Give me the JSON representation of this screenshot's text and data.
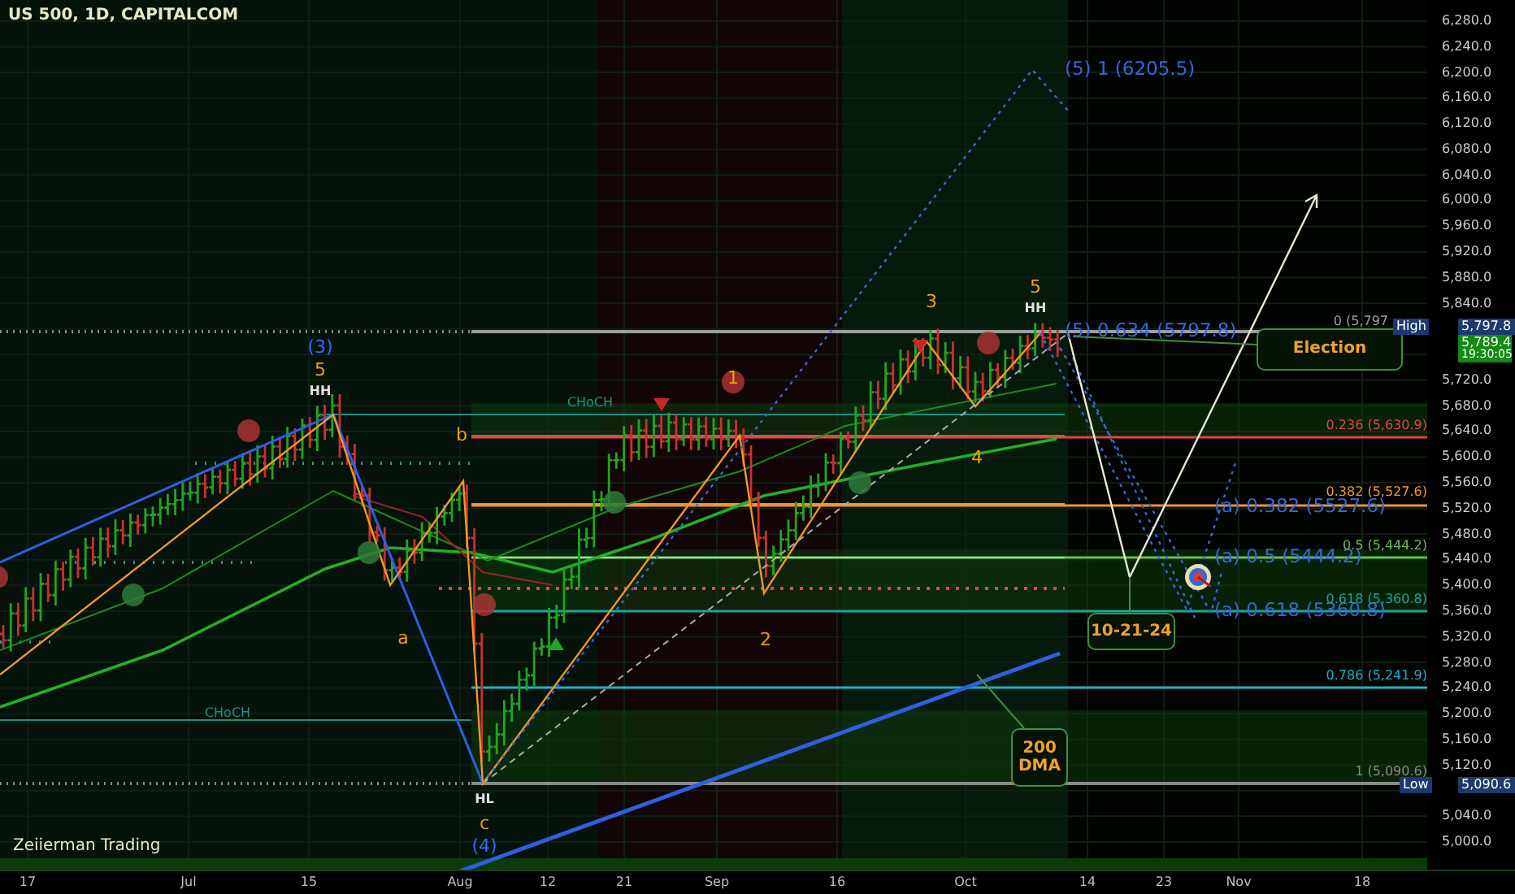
{
  "chart": {
    "title": "US 500, 1D, CAPITALCOM",
    "signature": "Zeiierman Trading",
    "wave_labels": [
      {
        "text": "(3)",
        "kind": "major"
      },
      {
        "text": "5",
        "kind": "minor"
      },
      {
        "text": "HH",
        "kind": "swing"
      },
      {
        "text": "1",
        "kind": "minor"
      },
      {
        "text": "3",
        "kind": "minor"
      },
      {
        "text": "5",
        "kind": "minor"
      },
      {
        "text": "HH",
        "kind": "swing"
      },
      {
        "text": "b",
        "kind": "minor"
      },
      {
        "text": "4",
        "kind": "minor"
      },
      {
        "text": "a",
        "kind": "minor"
      },
      {
        "text": "2",
        "kind": "minor"
      },
      {
        "text": "HL",
        "kind": "swing"
      },
      {
        "text": "c",
        "kind": "minor"
      },
      {
        "text": "(4)",
        "kind": "major"
      }
    ],
    "structure_labels": [
      "CHoCH",
      "CHoCH"
    ],
    "projection_labels": [
      "(5) 1 (6205.5)",
      "(5) 0.634 (5797.8)",
      "(a) 0.382 (5527.6)",
      "(a) 0.5 (5444.2)",
      "(a) 0.618 (5360.8)"
    ],
    "fib_levels": [
      {
        "label": "0 (5,797",
        "color": "#9e9e9e"
      },
      {
        "label": "0.236 (5,630.9)",
        "color": "#e04848"
      },
      {
        "label": "0.382 (5,527.6)",
        "color": "#f0962a"
      },
      {
        "label": "0.5 (5,444.2)",
        "color": "#6dbb5a"
      },
      {
        "label": "0.618 (5,360.8)",
        "color": "#1fa39a"
      },
      {
        "label": "0.786 (5,241.9)",
        "color": "#1fb0c0"
      },
      {
        "label": "1 (5,090.6)",
        "color": "#8a8a8a"
      }
    ],
    "callouts": [
      "Election",
      "10-21-24",
      "200 DMA"
    ],
    "price_axis": {
      "ticks": [
        "6,280.0",
        "6,240.0",
        "6,200.0",
        "6,160.0",
        "6,120.0",
        "6,080.0",
        "6,040.0",
        "6,000.0",
        "5,960.0",
        "5,920.0",
        "5,880.0",
        "5,840.0",
        "5,720.0",
        "5,680.0",
        "5,640.0",
        "5,600.0",
        "5,560.0",
        "5,520.0",
        "5,480.0",
        "5,440.0",
        "5,400.0",
        "5,360.0",
        "5,320.0",
        "5,280.0",
        "5,240.0",
        "5,200.0",
        "5,160.0",
        "5,120.0",
        "5,040.0",
        "5,000.0"
      ],
      "high": {
        "tag": "High",
        "price": "5,797.8"
      },
      "last": {
        "price": "5,789.4",
        "countdown": "19:30:05"
      },
      "low": {
        "tag": "Low",
        "price": "5,090.6"
      }
    },
    "time_axis": [
      "17",
      "Jul",
      "15",
      "Aug",
      "12",
      "21",
      "Sep",
      "16",
      "Oct",
      "14",
      "23",
      "Nov",
      "18"
    ]
  }
}
